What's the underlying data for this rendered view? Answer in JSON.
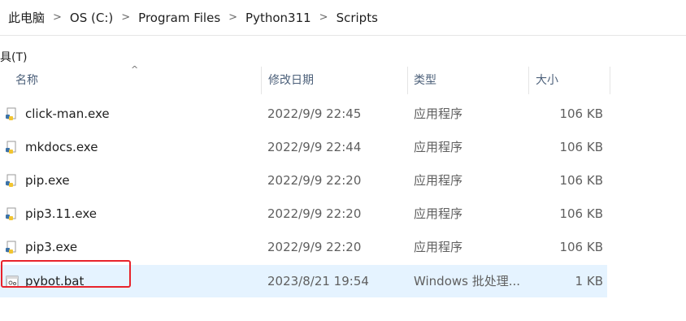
{
  "breadcrumb": [
    "此电脑",
    "OS (C:)",
    "Program Files",
    "Python311",
    "Scripts"
  ],
  "menubar": {
    "item": "具(T)"
  },
  "columns": {
    "name": "名称",
    "date": "修改日期",
    "type": "类型",
    "size": "大小"
  },
  "files": [
    {
      "name": "click-man.exe",
      "date": "2022/9/9 22:45",
      "type": "应用程序",
      "size": "106 KB",
      "icon": "python-exe-icon"
    },
    {
      "name": "mkdocs.exe",
      "date": "2022/9/9 22:44",
      "type": "应用程序",
      "size": "106 KB",
      "icon": "python-exe-icon"
    },
    {
      "name": "pip.exe",
      "date": "2022/9/9 22:20",
      "type": "应用程序",
      "size": "106 KB",
      "icon": "python-exe-icon"
    },
    {
      "name": "pip3.11.exe",
      "date": "2022/9/9 22:20",
      "type": "应用程序",
      "size": "106 KB",
      "icon": "python-exe-icon"
    },
    {
      "name": "pip3.exe",
      "date": "2022/9/9 22:20",
      "type": "应用程序",
      "size": "106 KB",
      "icon": "python-exe-icon"
    },
    {
      "name": "pybot.bat",
      "date": "2023/8/21 19:54",
      "type": "Windows 批处理...",
      "size": "1 KB",
      "icon": "batch-file-icon",
      "selected": true
    }
  ],
  "colors": {
    "selection": "#e5f3ff",
    "highlight_border": "#e8232b",
    "header_text": "#4c607a"
  }
}
